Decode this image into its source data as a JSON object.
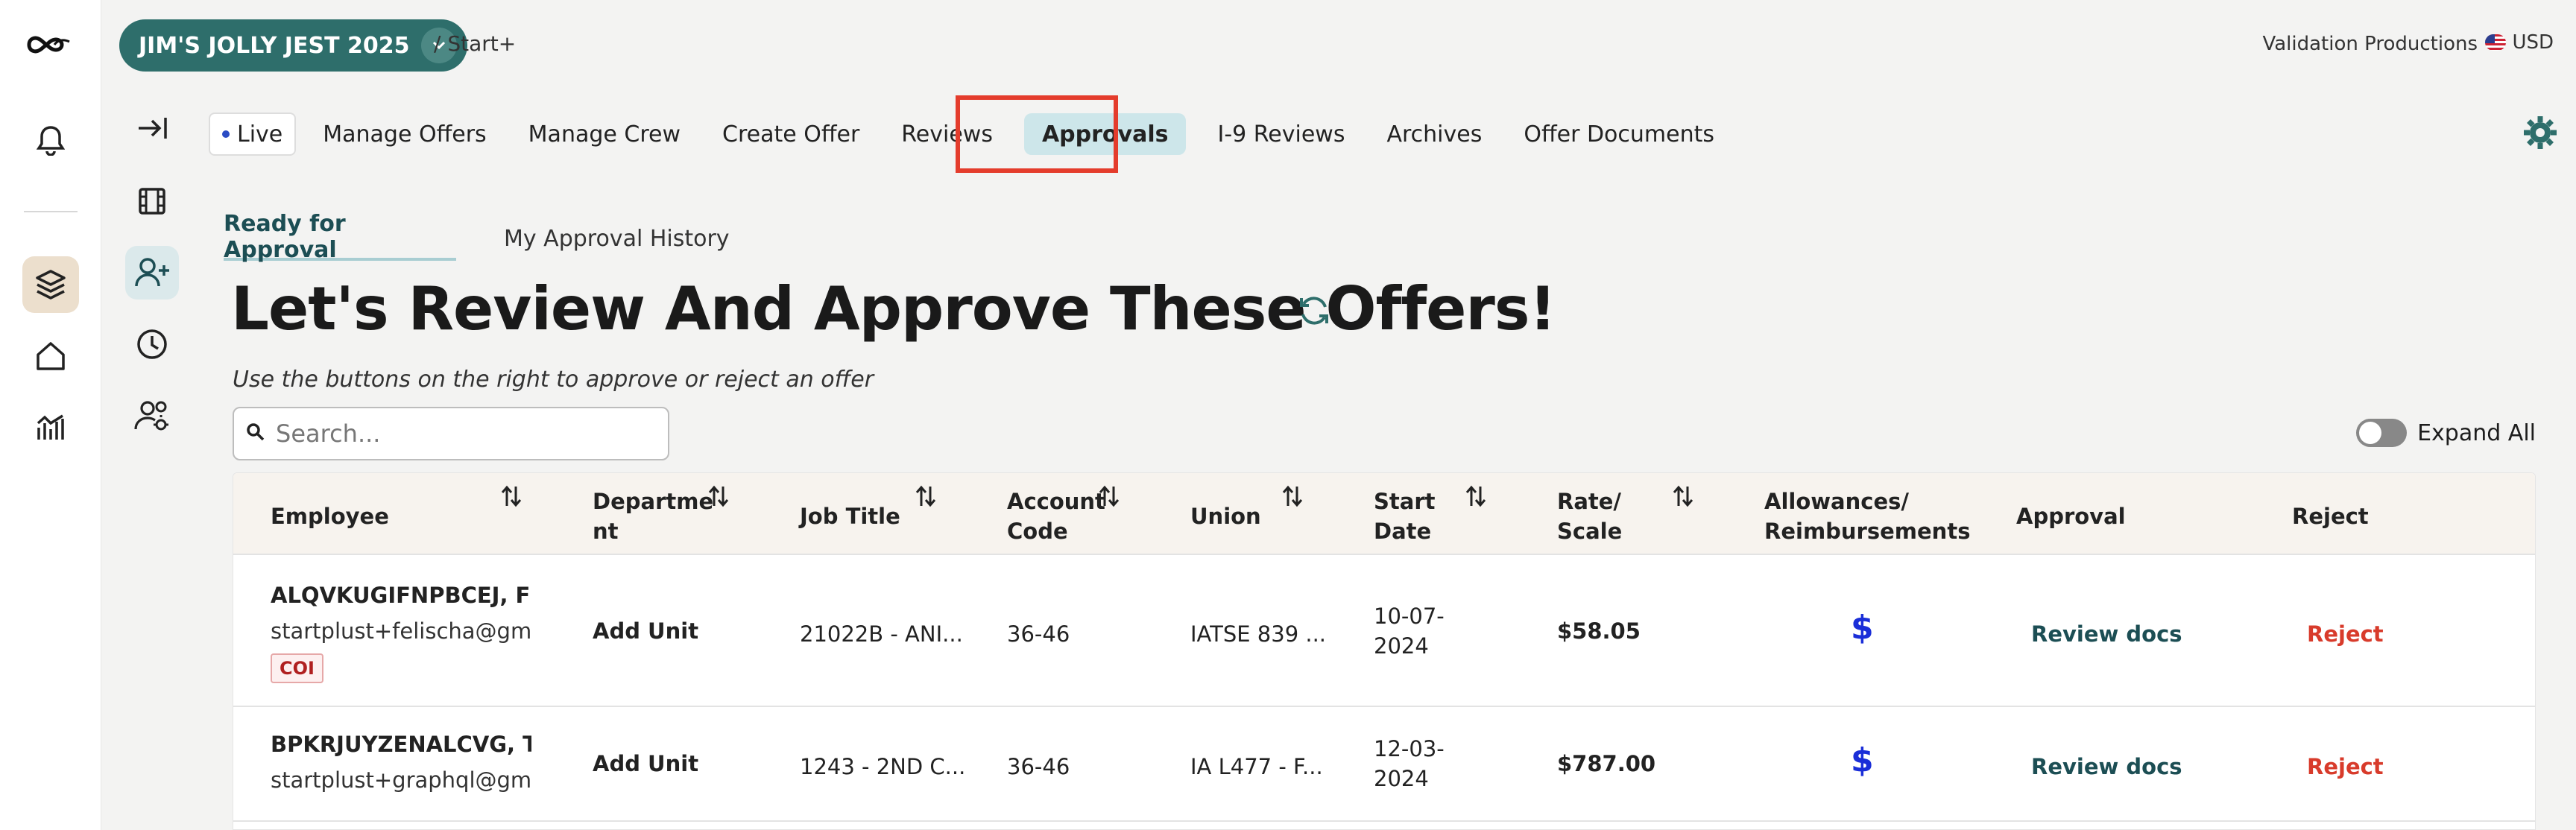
{
  "header": {
    "project_name": "JIM'S JOLLY JEST 2025",
    "breadcrumb": "/ Start+",
    "company": "Validation Productions",
    "currency": "USD"
  },
  "nav": {
    "live_label": "Live",
    "items": [
      "Manage Offers",
      "Manage Crew",
      "Create Offer",
      "Reviews",
      "Approvals",
      "I-9 Reviews",
      "Archives",
      "Offer Documents"
    ],
    "selected": "Approvals"
  },
  "tabs": {
    "ready": "Ready for Approval",
    "history": "My Approval History"
  },
  "page": {
    "title": "Let's Review And Approve These Offers!",
    "hint": "Use the buttons on the right to approve or reject an offer",
    "search_placeholder": "Search...",
    "expand_all": "Expand All"
  },
  "table": {
    "headers": {
      "employee": "Employee",
      "department_1": "Departme",
      "department_2": "nt",
      "job_title": "Job Title",
      "account_1": "Account",
      "account_2": "Code",
      "union": "Union",
      "start_1": "Start",
      "start_2": "Date",
      "rate_1": "Rate/",
      "rate_2": "Scale",
      "allow_1": "Allowances/",
      "allow_2": "Reimbursements",
      "approval": "Approval",
      "reject": "Reject"
    },
    "rows": [
      {
        "name": "ALQVKUGIFNPBCEJ, FE...",
        "email": "startplust+felischa@gm...",
        "badge": "COI",
        "department": "Add Unit",
        "job_title": "21022B - ANI...",
        "account_code": "36-46",
        "union": "IATSE 839 ...",
        "start_1": "10-07-",
        "start_2": "2024",
        "rate": "$58.05",
        "allowance": "$",
        "approval": "Review docs",
        "reject": "Reject"
      },
      {
        "name": "BPKRJUYZENALCVG, TI...",
        "email": "startplust+graphql@gm...",
        "department": "Add Unit",
        "job_title": "1243 - 2ND C...",
        "account_code": "36-46",
        "union": "IA L477 - F...",
        "start_1": "12-03-",
        "start_2": "2024",
        "rate": "$787.00",
        "allowance": "$",
        "approval": "Review docs",
        "reject": "Reject"
      }
    ]
  }
}
